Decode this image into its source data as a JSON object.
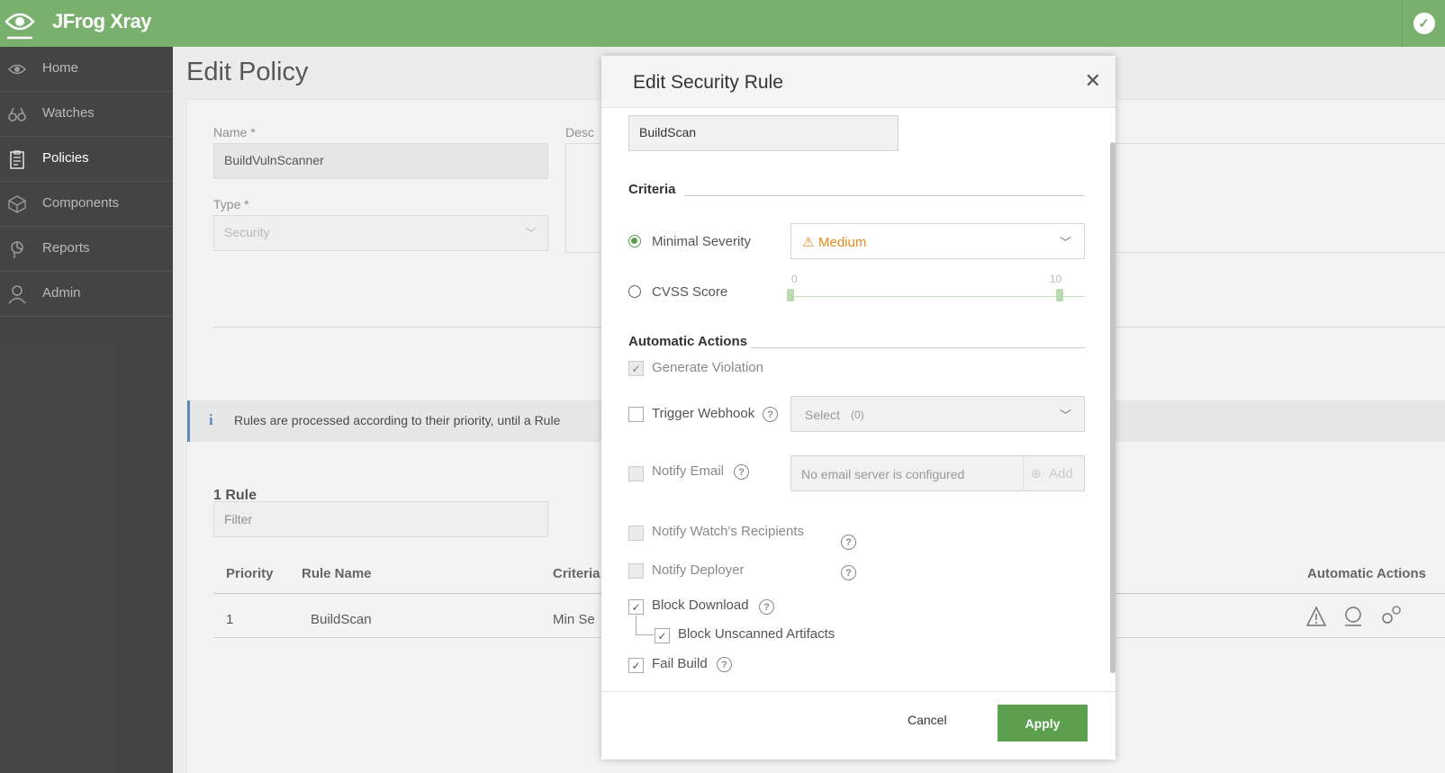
{
  "app": {
    "title": "JFrog Xray"
  },
  "sidebar": {
    "items": [
      {
        "label": "Home",
        "icon": "eye-icon"
      },
      {
        "label": "Watches",
        "icon": "binoculars-icon"
      },
      {
        "label": "Policies",
        "icon": "clipboard-icon",
        "active": true
      },
      {
        "label": "Components",
        "icon": "cube-icon"
      },
      {
        "label": "Reports",
        "icon": "report-icon"
      },
      {
        "label": "Admin",
        "icon": "user-icon"
      }
    ]
  },
  "page": {
    "title": "Edit Policy",
    "name_label": "Name *",
    "name_value": "BuildVulnScanner",
    "desc_label": "Desc",
    "type_label": "Type *",
    "type_value": "Security",
    "info_text": "Rules are processed according to their priority, until a Rule",
    "rule_count": "1 Rule",
    "filter_placeholder": "Filter",
    "table": {
      "headers": [
        "Priority",
        "Rule Name",
        "Criteria",
        "Automatic Actions"
      ],
      "rows": [
        {
          "priority": "1",
          "rule_name": "BuildScan",
          "criteria": "Min Se"
        }
      ]
    }
  },
  "modal": {
    "title": "Edit Security Rule",
    "rule_name_value": "BuildScan",
    "criteria_label": "Criteria",
    "minimal_severity_label": "Minimal Severity",
    "severity_value": "Medium",
    "cvss_label": "CVSS Score",
    "cvss_min": "0",
    "cvss_max": "10",
    "auto_actions_label": "Automatic Actions",
    "generate_violation": "Generate Violation",
    "trigger_webhook": "Trigger Webhook",
    "webhook_select": "Select",
    "webhook_count": "(0)",
    "notify_email": "Notify Email",
    "email_placeholder": "No email server is configured",
    "email_add": "Add",
    "notify_watch": "Notify Watch's Recipients",
    "notify_deployer": "Notify Deployer",
    "block_download": "Block Download",
    "block_unscanned": "Block Unscanned Artifacts",
    "fail_build": "Fail Build",
    "cancel": "Cancel",
    "apply": "Apply"
  },
  "colors": {
    "brand": "#5c9f4e",
    "severity_medium": "#e8891c",
    "sidebar": "#1c1c1c"
  }
}
